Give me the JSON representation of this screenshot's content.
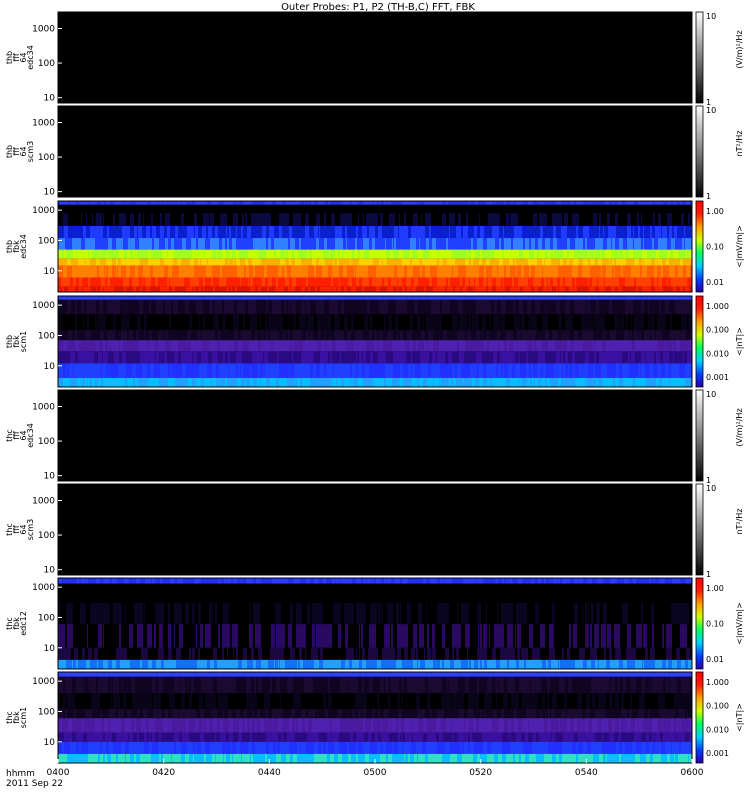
{
  "title": "Outer Probes: P1, P2 (TH-B,C) FFT, FBK",
  "time_axis": {
    "label_line1": "hhmm",
    "label_line2": "2011 Sep 22",
    "ticks": [
      "0400",
      "0420",
      "0440",
      "0500",
      "0520",
      "0540",
      "0600"
    ]
  },
  "chart_data": [
    {
      "type": "heatmap",
      "probe": "thb",
      "ylabel": [
        "thb",
        "fff",
        "64",
        "edc34"
      ],
      "yticks": [
        "10",
        "100",
        "1000"
      ],
      "ylim": [
        7,
        3000
      ],
      "yscale": "log",
      "colorbar": {
        "ticks": [
          "1",
          "10"
        ],
        "label": "(V/m)²/Hz",
        "colors": [
          "#000000",
          "#ffffff"
        ]
      },
      "pattern": "empty"
    },
    {
      "type": "heatmap",
      "probe": "thb",
      "ylabel": [
        "thb",
        "fff",
        "64",
        "scm3"
      ],
      "yticks": [
        "10",
        "100",
        "1000"
      ],
      "ylim": [
        7,
        3000
      ],
      "yscale": "log",
      "colorbar": {
        "ticks": [
          "1",
          "10"
        ],
        "label": "nT²/Hz",
        "colors": [
          "#000000",
          "#ffffff"
        ]
      },
      "pattern": "empty"
    },
    {
      "type": "heatmap",
      "probe": "thb",
      "ylabel": [
        "thb",
        "fbk",
        "edc34"
      ],
      "yticks": [
        "10",
        "100",
        "1000"
      ],
      "ylim": [
        2,
        2000
      ],
      "yscale": "log",
      "colorbar": {
        "ticks": [
          "1.00",
          "0.10",
          "0.01"
        ],
        "label": "<|mV/m|>",
        "colors": [
          "#2a00a6",
          "#0040ff",
          "#00d0ff",
          "#00ff60",
          "#d0ff00",
          "#ffa000",
          "#ff2000",
          "#ff0000"
        ]
      },
      "bands": [
        {
          "yfrom": 1500,
          "yto": 2000,
          "colors": [
            "#2a3cff",
            "#2030ee"
          ]
        },
        {
          "yfrom": 800,
          "yto": 1500,
          "colors": [
            "#000000"
          ]
        },
        {
          "yfrom": 300,
          "yto": 800,
          "colors": [
            "#000000",
            "#0a0a40"
          ]
        },
        {
          "yfrom": 120,
          "yto": 300,
          "colors": [
            "#1f3bff",
            "#0a20d0"
          ]
        },
        {
          "yfrom": 50,
          "yto": 120,
          "colors": [
            "#2040ff",
            "#3080ff"
          ]
        },
        {
          "yfrom": 25,
          "yto": 50,
          "colors": [
            "#c8ff00",
            "#a0ff20"
          ]
        },
        {
          "yfrom": 15,
          "yto": 25,
          "colors": [
            "#ffd000",
            "#ffb000"
          ]
        },
        {
          "yfrom": 6,
          "yto": 15,
          "colors": [
            "#ff8000",
            "#ff6000"
          ]
        },
        {
          "yfrom": 3,
          "yto": 6,
          "colors": [
            "#ff4000",
            "#ff2000"
          ]
        },
        {
          "yfrom": 2,
          "yto": 3,
          "colors": [
            "#ff2000",
            "#e01000"
          ]
        }
      ]
    },
    {
      "type": "heatmap",
      "probe": "thb",
      "ylabel": [
        "thb",
        "fbk",
        "scm1"
      ],
      "yticks": [
        "10",
        "100",
        "1000"
      ],
      "ylim": [
        2,
        2000
      ],
      "yscale": "log",
      "colorbar": {
        "ticks": [
          "1.000",
          "0.100",
          "0.010",
          "0.001"
        ],
        "label": "<|nT|>",
        "colors": [
          "#2a00a6",
          "#0040ff",
          "#00d0ff",
          "#00ff60",
          "#d0ff00",
          "#ffa000",
          "#ff2000",
          "#ff0000"
        ]
      },
      "bands": [
        {
          "yfrom": 1500,
          "yto": 2000,
          "colors": [
            "#3040ff"
          ]
        },
        {
          "yfrom": 500,
          "yto": 1500,
          "colors": [
            "#1a0a30",
            "#100520"
          ]
        },
        {
          "yfrom": 150,
          "yto": 500,
          "colors": [
            "#0a0418",
            "#000000"
          ]
        },
        {
          "yfrom": 70,
          "yto": 150,
          "colors": [
            "#100520",
            "#1a0a30"
          ]
        },
        {
          "yfrom": 30,
          "yto": 70,
          "colors": [
            "#4a1aa0",
            "#5020b0"
          ]
        },
        {
          "yfrom": 12,
          "yto": 30,
          "colors": [
            "#3a10a0",
            "#2a0a80"
          ]
        },
        {
          "yfrom": 4,
          "yto": 12,
          "colors": [
            "#1f30ff",
            "#2040ff"
          ]
        },
        {
          "yfrom": 2,
          "yto": 4,
          "colors": [
            "#00c0ff",
            "#20a0ff"
          ]
        }
      ]
    },
    {
      "type": "heatmap",
      "probe": "thc",
      "ylabel": [
        "thc",
        "fff",
        "64",
        "edc34"
      ],
      "yticks": [
        "10",
        "100",
        "1000"
      ],
      "ylim": [
        7,
        3000
      ],
      "yscale": "log",
      "colorbar": {
        "ticks": [
          "1",
          "10"
        ],
        "label": "(V/m)²/Hz",
        "colors": [
          "#000000",
          "#ffffff"
        ]
      },
      "pattern": "empty"
    },
    {
      "type": "heatmap",
      "probe": "thc",
      "ylabel": [
        "thc",
        "fff",
        "64",
        "scm3"
      ],
      "yticks": [
        "10",
        "100",
        "1000"
      ],
      "ylim": [
        7,
        3000
      ],
      "yscale": "log",
      "colorbar": {
        "ticks": [
          "1",
          "10"
        ],
        "label": "nT²/Hz",
        "colors": [
          "#000000",
          "#ffffff"
        ]
      },
      "pattern": "empty"
    },
    {
      "type": "heatmap",
      "probe": "thc",
      "ylabel": [
        "thc",
        "fbk",
        "edc12"
      ],
      "yticks": [
        "10",
        "100",
        "1000"
      ],
      "ylim": [
        2,
        2000
      ],
      "yscale": "log",
      "colorbar": {
        "ticks": [
          "1.00",
          "0.10",
          "0.01"
        ],
        "label": "<|mV/m|>",
        "colors": [
          "#2a00a6",
          "#0040ff",
          "#00d0ff",
          "#00ff60",
          "#d0ff00",
          "#ffa000",
          "#ff2000",
          "#ff0000"
        ]
      },
      "bands": [
        {
          "yfrom": 1300,
          "yto": 2000,
          "colors": [
            "#2a3cff",
            "#2030ee"
          ]
        },
        {
          "yfrom": 300,
          "yto": 1300,
          "colors": [
            "#000000"
          ]
        },
        {
          "yfrom": 60,
          "yto": 300,
          "colors": [
            "#000000",
            "#0a0520"
          ]
        },
        {
          "yfrom": 10,
          "yto": 60,
          "colors": [
            "#000000",
            "#2a0a60"
          ]
        },
        {
          "yfrom": 4,
          "yto": 10,
          "colors": [
            "#1a0840",
            "#000000"
          ]
        },
        {
          "yfrom": 2,
          "yto": 4,
          "colors": [
            "#20a0ff",
            "#1070ff"
          ]
        }
      ]
    },
    {
      "type": "heatmap",
      "probe": "thc",
      "ylabel": [
        "thc",
        "fbk",
        "scm1"
      ],
      "yticks": [
        "10",
        "100",
        "1000"
      ],
      "ylim": [
        2,
        2000
      ],
      "yscale": "log",
      "colorbar": {
        "ticks": [
          "1.000",
          "0.100",
          "0.010",
          "0.001"
        ],
        "label": "<|nT|>",
        "colors": [
          "#2a00a6",
          "#0040ff",
          "#00d0ff",
          "#00ff60",
          "#d0ff00",
          "#ffa000",
          "#ff2000",
          "#ff0000"
        ]
      },
      "bands": [
        {
          "yfrom": 1400,
          "yto": 2000,
          "colors": [
            "#3040ff"
          ]
        },
        {
          "yfrom": 400,
          "yto": 1400,
          "colors": [
            "#1a0a30",
            "#100520"
          ]
        },
        {
          "yfrom": 120,
          "yto": 400,
          "colors": [
            "#0a0418",
            "#000000"
          ]
        },
        {
          "yfrom": 60,
          "yto": 120,
          "colors": [
            "#100520",
            "#1a0a30"
          ]
        },
        {
          "yfrom": 20,
          "yto": 60,
          "colors": [
            "#5020b0",
            "#4a1aa0"
          ]
        },
        {
          "yfrom": 10,
          "yto": 20,
          "colors": [
            "#3a10a0",
            "#2a0a80"
          ]
        },
        {
          "yfrom": 4,
          "yto": 10,
          "colors": [
            "#1f30ff",
            "#2040ff"
          ]
        },
        {
          "yfrom": 2,
          "yto": 4,
          "colors": [
            "#00c0ff",
            "#30e0c0"
          ]
        }
      ]
    }
  ]
}
